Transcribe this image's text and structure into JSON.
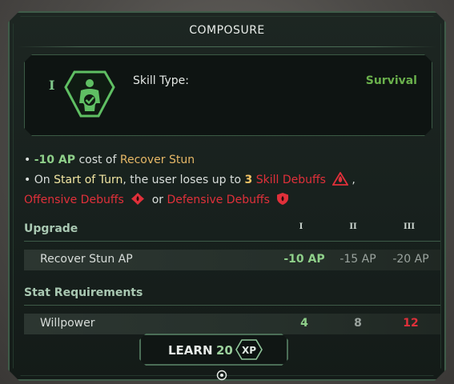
{
  "title": "COMPOSURE",
  "skill": {
    "tier": "I",
    "type_label": "Skill Type:",
    "type_value": "Survival",
    "icon": "figure-check-icon"
  },
  "description": {
    "line1": {
      "bullet": "•",
      "ap": "-10 AP",
      "text": "cost of",
      "target": "Recover Stun"
    },
    "line2": {
      "bullet": "•",
      "prefix": "On",
      "trigger": "Start of Turn",
      "mid": ", the user loses up to",
      "count": "3",
      "debuff": "Skill Debuffs",
      "sep": ","
    },
    "line3": {
      "debuff1": "Offensive Debuffs",
      "or": "or",
      "debuff2": "Defensive Debuffs"
    }
  },
  "upgrade": {
    "heading": "Upgrade",
    "columns": [
      "I",
      "II",
      "III"
    ],
    "row_label": "Recover Stun AP",
    "values": [
      "-10 AP",
      "-15 AP",
      "-20 AP"
    ]
  },
  "requirements": {
    "heading": "Stat Requirements",
    "row_label": "Willpower",
    "values": [
      "4",
      "8",
      "12"
    ]
  },
  "learn": {
    "label": "LEARN",
    "cost": "20",
    "unit": "XP"
  },
  "colors": {
    "accent_green": "#6ab04c",
    "ap_green": "#8fd08a",
    "debuff_red": "#e0303a",
    "gold": "#e7b867"
  }
}
